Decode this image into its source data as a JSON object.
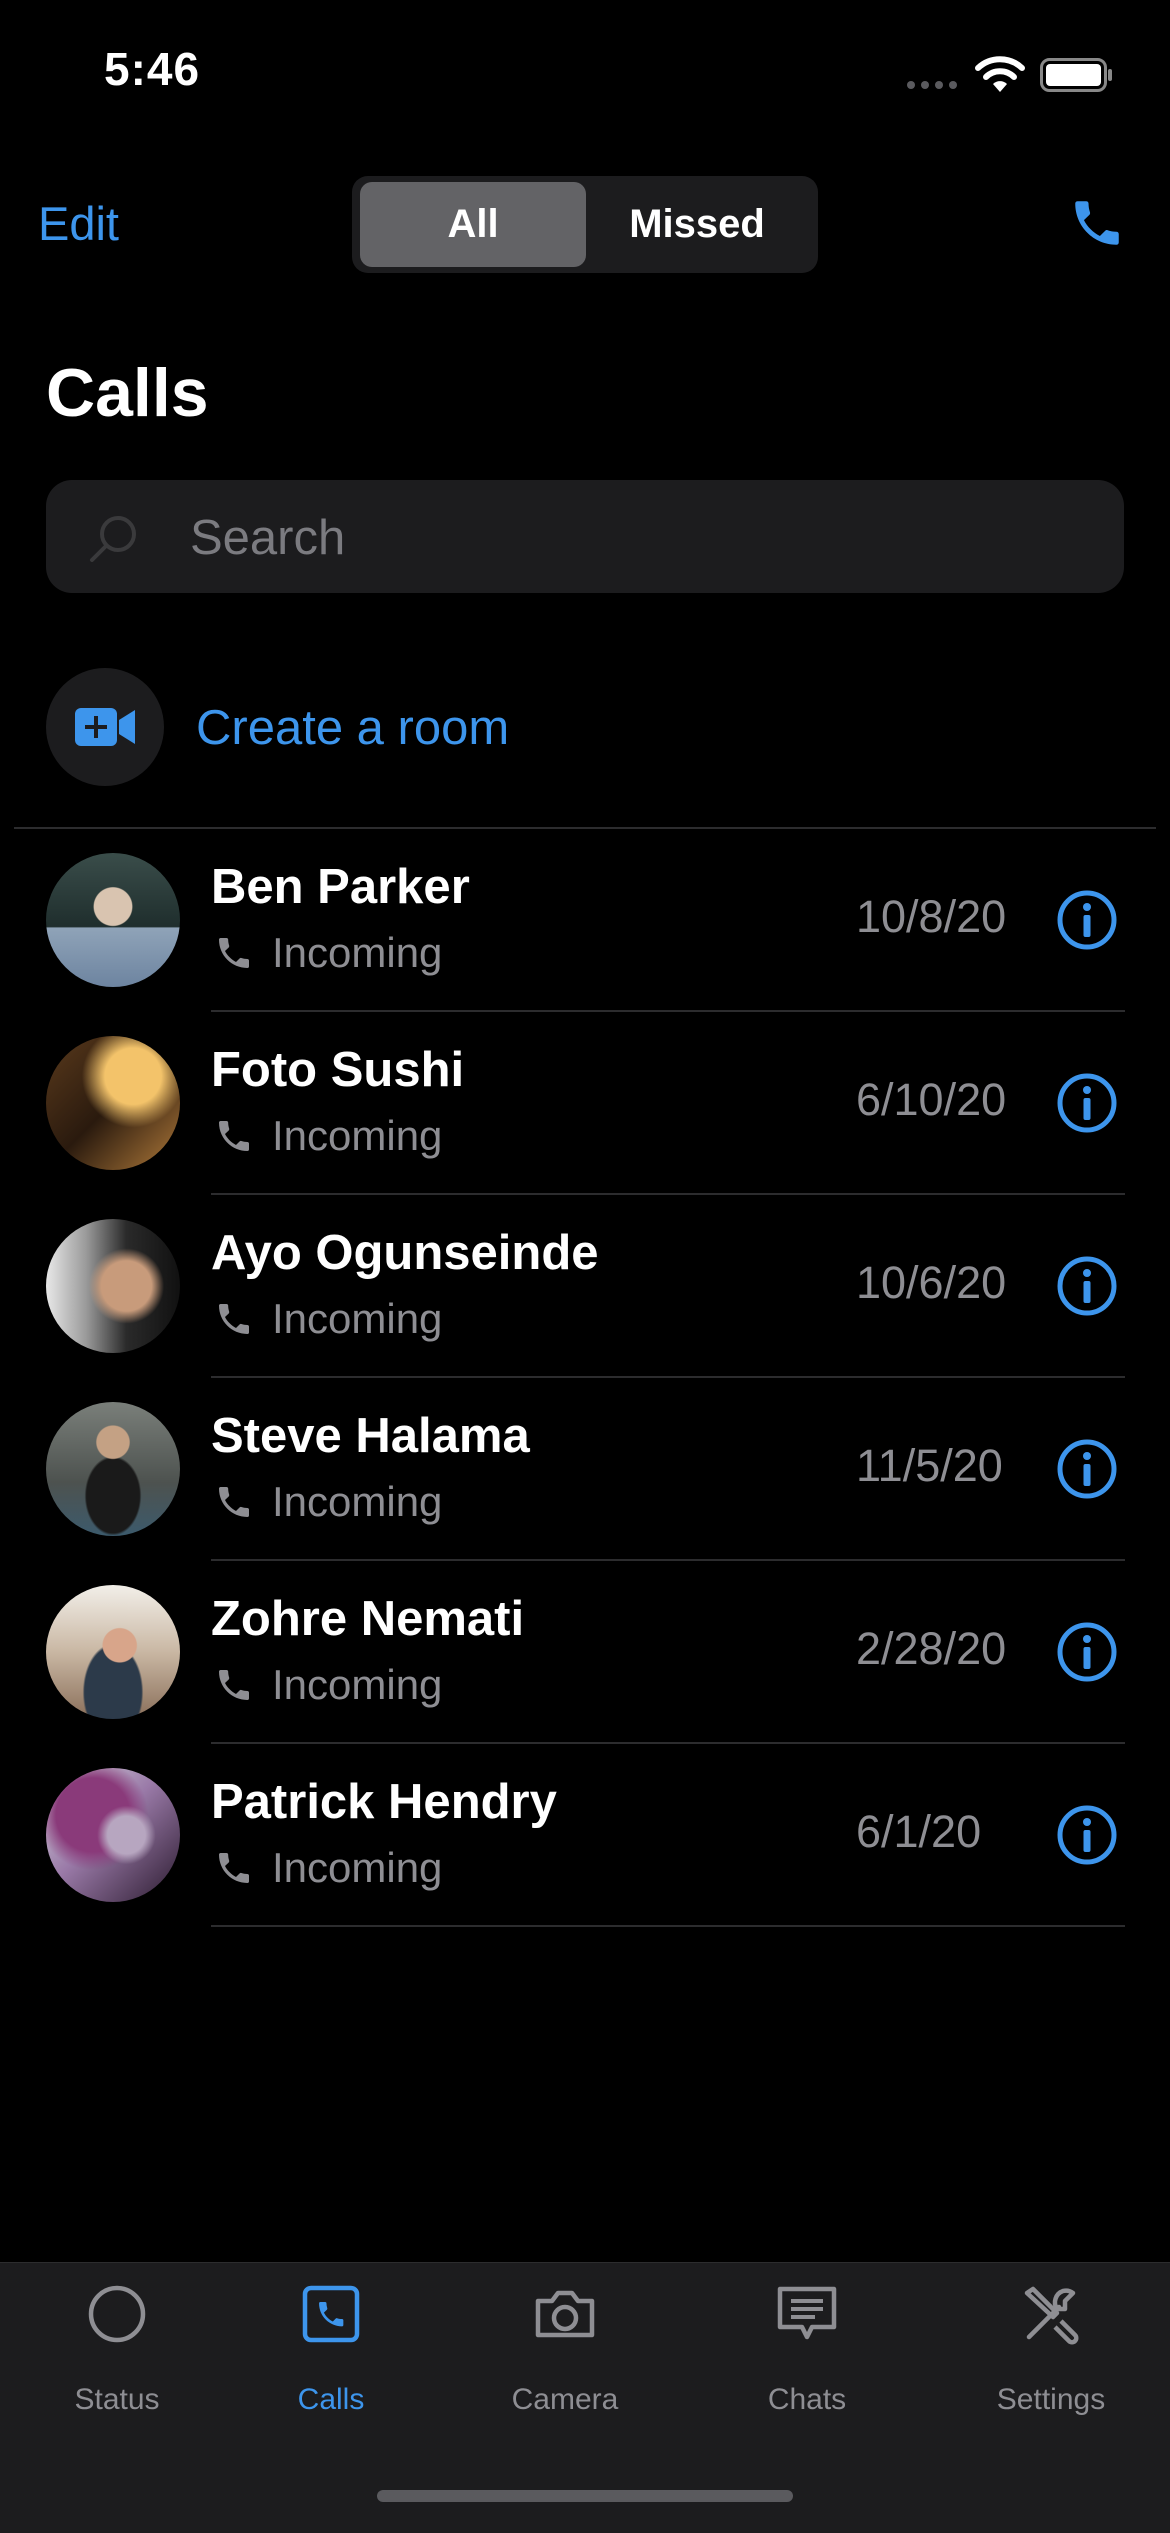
{
  "status_bar": {
    "time": "5:46"
  },
  "nav": {
    "edit_label": "Edit",
    "segments": [
      "All",
      "Missed"
    ],
    "selected_segment": "All"
  },
  "page": {
    "title": "Calls"
  },
  "search": {
    "placeholder": "Search"
  },
  "create_room": {
    "label": "Create a room"
  },
  "calls": [
    {
      "name": "Ben Parker",
      "type": "Incoming",
      "date": "10/8/20"
    },
    {
      "name": "Foto Sushi",
      "type": "Incoming",
      "date": "6/10/20"
    },
    {
      "name": "Ayo Ogunseinde",
      "type": "Incoming",
      "date": "10/6/20"
    },
    {
      "name": "Steve Halama",
      "type": "Incoming",
      "date": "11/5/20"
    },
    {
      "name": "Zohre Nemati",
      "type": "Incoming",
      "date": "2/28/20"
    },
    {
      "name": "Patrick Hendry",
      "type": "Incoming",
      "date": "6/1/20"
    }
  ],
  "tab_bar": {
    "items": [
      {
        "label": "Status",
        "icon": "status-circle-icon"
      },
      {
        "label": "Calls",
        "icon": "calls-icon"
      },
      {
        "label": "Camera",
        "icon": "camera-icon"
      },
      {
        "label": "Chats",
        "icon": "chats-icon"
      },
      {
        "label": "Settings",
        "icon": "settings-icon"
      }
    ],
    "active": "Calls"
  },
  "colors": {
    "accent": "#3d95ec",
    "background": "#000000",
    "secondary_text": "#8e8e93",
    "surface": "#1c1c1e"
  }
}
